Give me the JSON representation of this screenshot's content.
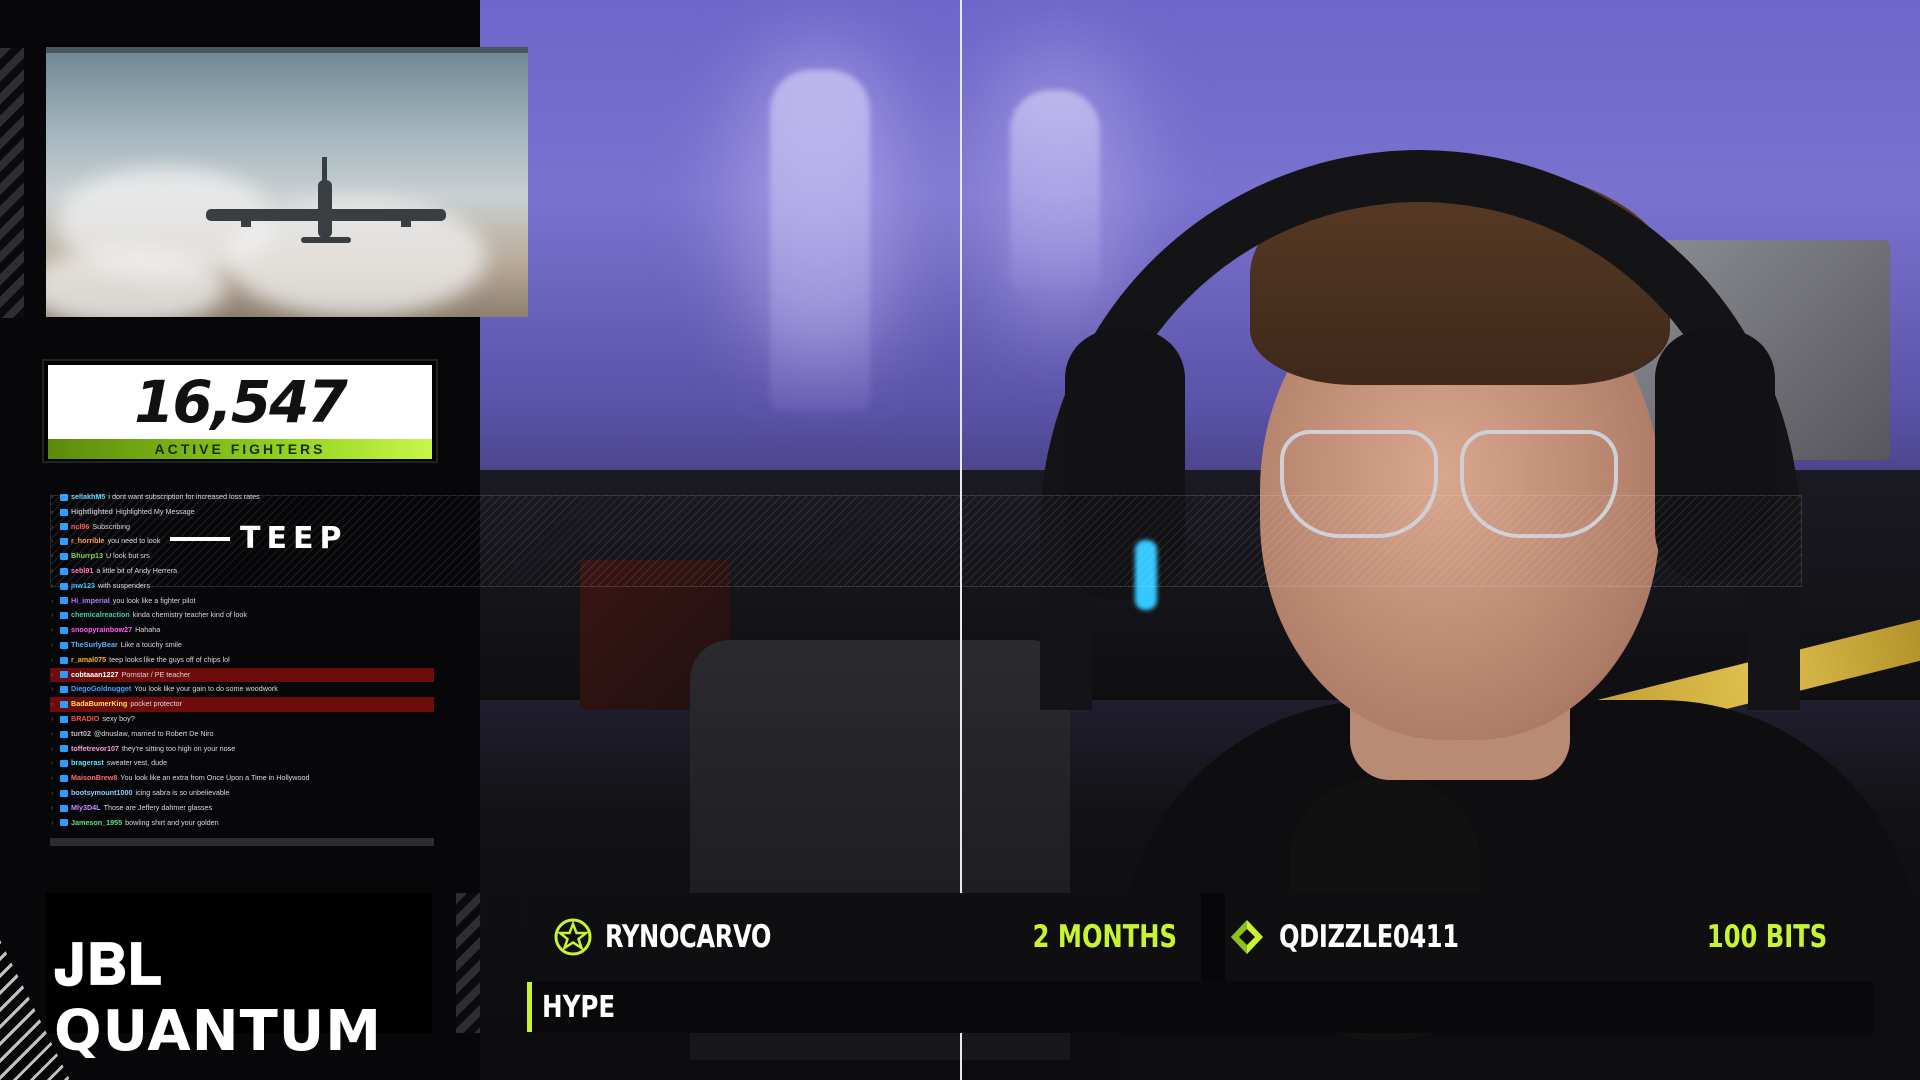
{
  "game_preview": {},
  "counter": {
    "value": "16,547",
    "label": "ACTIVE FIGHTERS"
  },
  "chat": {
    "messages": [
      {
        "user": "sellakhM5",
        "text": "i dont want subscription for increased loss rates",
        "color": "#5fd7ff"
      },
      {
        "user": "Hightlighted",
        "text": "Highlighted My Message",
        "color": "#b4b4bd"
      },
      {
        "user": "ncl96",
        "text": "Subscribing",
        "color": "#ff5c5c"
      },
      {
        "user": "r_horrible",
        "text": "you need to look",
        "color": "#ff9f43"
      },
      {
        "user": "Bhurrp13",
        "text": "U look but srs",
        "color": "#7cdb4a"
      },
      {
        "user": "sebl91",
        "text": "a little bit of Andy Herrera",
        "color": "#ff7ab6"
      },
      {
        "user": "jnw123",
        "text": "with suspenders",
        "color": "#36c1ff"
      },
      {
        "user": "Hi_imperial",
        "text": "you look like a fighter pilot",
        "color": "#b57bff"
      },
      {
        "user": "chemicalreaction",
        "text": "kinda chemistry teacher kind of look",
        "color": "#3bd1a6"
      },
      {
        "user": "snoopyrainbow27",
        "text": "Hahaha",
        "color": "#ff5cf0"
      },
      {
        "user": "TheSurlyBear",
        "text": "Like a touchy smile",
        "color": "#56b6ff"
      },
      {
        "user": "r_amal075",
        "text": "teep looks like the guys off of chips lol",
        "color": "#ffb020"
      },
      {
        "user": "cobtaaan1227",
        "text": "Pornstar / PE teacher",
        "color": "#ffffff",
        "highlight": true
      },
      {
        "user": "DiegoGoldnugget",
        "text": "You look like your gain to do some woodwork",
        "color": "#48a1ff"
      },
      {
        "user": "BadaBumerKing",
        "text": "pocket protector",
        "color": "#ffe14d",
        "highlight": true
      },
      {
        "user": "BRADIO",
        "text": "sexy boy?",
        "color": "#ff5151"
      },
      {
        "user": "turt02",
        "text": "@dnuslaw, married to Robert De Niro",
        "color": "#bdbdbd"
      },
      {
        "user": "toffetrevor107",
        "text": "they're sitting too high on your nose",
        "color": "#ff9bd8"
      },
      {
        "user": "bragerast",
        "text": "sweater vest, dude",
        "color": "#5de3ff"
      },
      {
        "user": "MaisonBrew8",
        "text": "You look like an extra from Once Upon a Time in Hollywood",
        "color": "#ff6b6b"
      },
      {
        "user": "bootsymount1000",
        "text": "icing sabra is so unbelievable",
        "color": "#8ad1ff"
      },
      {
        "user": "Mly3D4L",
        "text": "Those are Jeffery dahmer glasses",
        "color": "#c98bff"
      },
      {
        "user": "Jameson_1955",
        "text": "bowling shirt and your golden",
        "color": "#60e07a"
      }
    ]
  },
  "teep": {
    "label": "TEEP"
  },
  "sponsor": {
    "logo_text": "JBL QUANTUM"
  },
  "alerts": {
    "sub": {
      "user": "RYNOCARVO",
      "value": "2 MONTHS",
      "icon": "star-badge-icon"
    },
    "bits": {
      "user": "QDIZZLE0411",
      "value": "100 BITS",
      "icon": "bits-diamond-icon"
    },
    "hype": "HYPE",
    "accent_color": "#c8f532"
  }
}
